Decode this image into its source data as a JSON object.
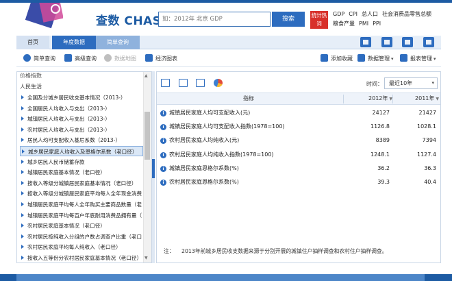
{
  "header": {
    "brand": "查数 CHASHU",
    "search_placeholder": "如：2012年 北京 GDP",
    "search_button": "搜索",
    "hot_badge": "统计热词",
    "hot_links": [
      "GDP",
      "CPI",
      "总人口",
      "社会消费品零售总额",
      "粮食产量",
      "PMI",
      "PPI"
    ]
  },
  "nav": {
    "home": "首页",
    "year_data": "年度数据",
    "quarter_query": "简单查询",
    "icons": [
      "download-icon",
      "archive-icon",
      "print-icon",
      "share-icon"
    ]
  },
  "toolbar": {
    "simple_query": "简单查询",
    "advanced_query": "高级查询",
    "data_map": "数据地图",
    "economic_chart": "经济图表",
    "add_favorite": "添加收藏",
    "data_manage": "数据管理",
    "report_manage": "报表管理"
  },
  "tree": {
    "cut_header": "价格指数",
    "section": "人民生活",
    "items": [
      "全国及分城乡居民收支基本情况（2013-）",
      "全国居民人均收入与支出（2013-）",
      "城镇居民人均收入与支出（2013-）",
      "农村居民人均收入与支出（2013-）",
      "居民人均可支配收入基尼系数（2013-）",
      "城乡居民家庭人均收入及恩格尔系数（老口径）",
      "城乡居民人民币储蓄存款",
      "城镇居民家庭基本情况（老口径）",
      "按收入等级分城镇居民家庭基本情况（老口径）",
      "按收入等级分城镇居民家庭平均每人全年现金消费",
      "城镇居民家庭平均每人全年购买主要商品数量（老",
      "城镇居民家庭平均每百户年底耐用消费品拥有量（",
      "农村居民家庭基本情况（老口径）",
      "农村居民按纯收入分组的户数占调查户比重（老口",
      "农村居民家庭平均每人纯收入（老口径）",
      "按收入五等份分农村居民家庭基本情况（老口径）"
    ],
    "selected_index": 5
  },
  "grid": {
    "time_label": "时间：",
    "time_value": "最近10年",
    "header": {
      "indicator": "指标",
      "y1": "2012年",
      "y2": "2011年"
    },
    "rows": [
      {
        "name": "城镇居民家庭人均可支配收入(元)",
        "v1": "24127",
        "v2": "21427"
      },
      {
        "name": "城镇居民家庭人均可支配收入指数(1978=100)",
        "v1": "1126.8",
        "v2": "1028.1"
      },
      {
        "name": "农村居民家庭人均纯收入(元)",
        "v1": "8389",
        "v2": "7394"
      },
      {
        "name": "农村居民家庭人均纯收入指数(1978=100)",
        "v1": "1248.1",
        "v2": "1127.4"
      },
      {
        "name": "城镇居民家庭恩格尔系数(%)",
        "v1": "36.2",
        "v2": "36.3"
      },
      {
        "name": "农村居民家庭恩格尔系数(%)",
        "v1": "39.3",
        "v2": "40.4"
      }
    ],
    "note_label": "注：",
    "note_text": "2013年前城乡居民收支数据来源于分别开展的城镇住户抽样调查和农村住户抽样调查。"
  }
}
